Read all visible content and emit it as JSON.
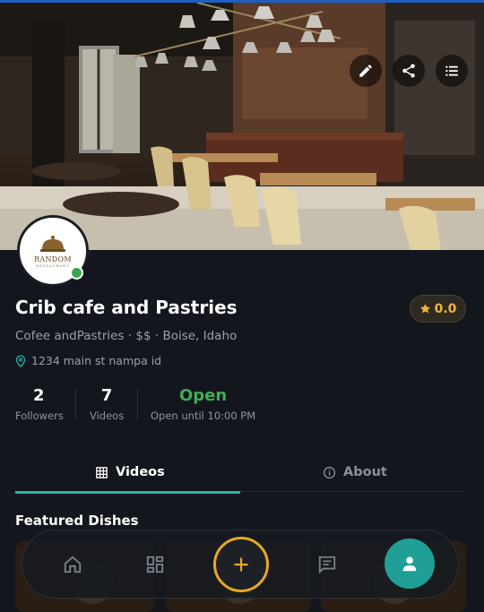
{
  "colors": {
    "accent_teal": "#23b5a9",
    "open_green": "#3fae56",
    "rating_gold": "#f2b43a",
    "add_ring": "#e6a823",
    "background": "#13171d"
  },
  "cover": {
    "actions": [
      {
        "name": "edit",
        "icon": "pencil-icon"
      },
      {
        "name": "share",
        "icon": "share-icon"
      },
      {
        "name": "menu",
        "icon": "list-icon"
      }
    ]
  },
  "profile": {
    "logo_title": "RANDOM",
    "logo_subtitle": "RESTAURANT",
    "online": true,
    "name": "Crib cafe and Pastries",
    "rating": "0.0",
    "subline": "Cofee andPastries · $$  ·  Boise, Idaho",
    "address": "1234 main st nampa id"
  },
  "stats": {
    "followers_count": "2",
    "followers_label": "Followers",
    "videos_count": "7",
    "videos_label": "Videos",
    "status": "Open",
    "status_detail": "Open until 10:00 PM"
  },
  "tabs": [
    {
      "label": "Videos",
      "icon": "grid-icon",
      "active": true
    },
    {
      "label": "About",
      "icon": "info-icon",
      "active": false
    }
  ],
  "featured": {
    "title": "Featured Dishes"
  },
  "bottom_nav": [
    {
      "name": "home",
      "icon": "home-icon"
    },
    {
      "name": "dashboard",
      "icon": "dashboard-icon"
    },
    {
      "name": "add",
      "icon": "plus-icon"
    },
    {
      "name": "messages",
      "icon": "chat-icon"
    },
    {
      "name": "profile",
      "icon": "person-icon",
      "active": true
    }
  ]
}
